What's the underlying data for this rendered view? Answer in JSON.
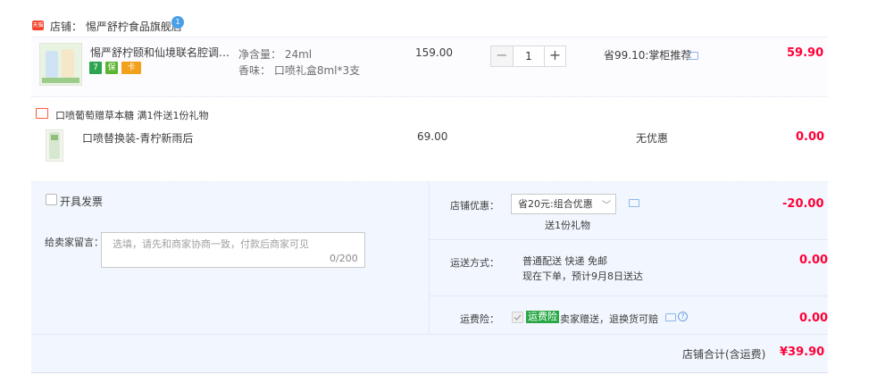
{
  "shop": {
    "icon_text": "天猫",
    "label": "店铺：  惕严舒柠食品旗舰店",
    "bubble": "1"
  },
  "item1": {
    "title": "惕严舒柠颐和仙境联名腔调小安…",
    "badges": [
      "7",
      "保",
      "卡"
    ],
    "spec1": "净含量：  24ml",
    "spec2": "香味：  口喷礼盒8ml*3支",
    "unit_price": "159.00",
    "qty_minus": "−",
    "quantity": "1",
    "qty_plus": "+",
    "promo": "省99.10:掌柜推荐",
    "total": "59.90"
  },
  "gift": {
    "text": "口喷葡萄赠草本糖    满1件送1份礼物"
  },
  "item2": {
    "title": "口喷替换装-青柠新雨后",
    "unit_price": "69.00",
    "promo": "无优惠",
    "total": "0.00"
  },
  "invoice": {
    "label": "开具发票"
  },
  "note": {
    "label": "给卖家留言：",
    "placeholder": "选填，请先和商家协商一致，付款后商家可见",
    "counter": "0/200"
  },
  "discount": {
    "label": "店铺优惠：",
    "selected": "省20元:组合优惠",
    "arrow": "﹀",
    "gift": "送1份礼物",
    "amount": "-20.00"
  },
  "shipping": {
    "label": "运送方式：",
    "line1": "普通配送 快递 免邮",
    "line2": "现在下单，预计9月8日送达",
    "amount": "0.00"
  },
  "insurance": {
    "label": "运费险：",
    "tag": "运费险",
    "desc": "卖家赠送，退换货可赔",
    "amount": "0.00"
  },
  "summary": {
    "label": "店铺合计(含运费)",
    "total": "¥39.90"
  },
  "colors": {
    "accent_red": "#ff0036",
    "panel_bg": "#f2f7ff",
    "insurance_green": "#28a745"
  }
}
